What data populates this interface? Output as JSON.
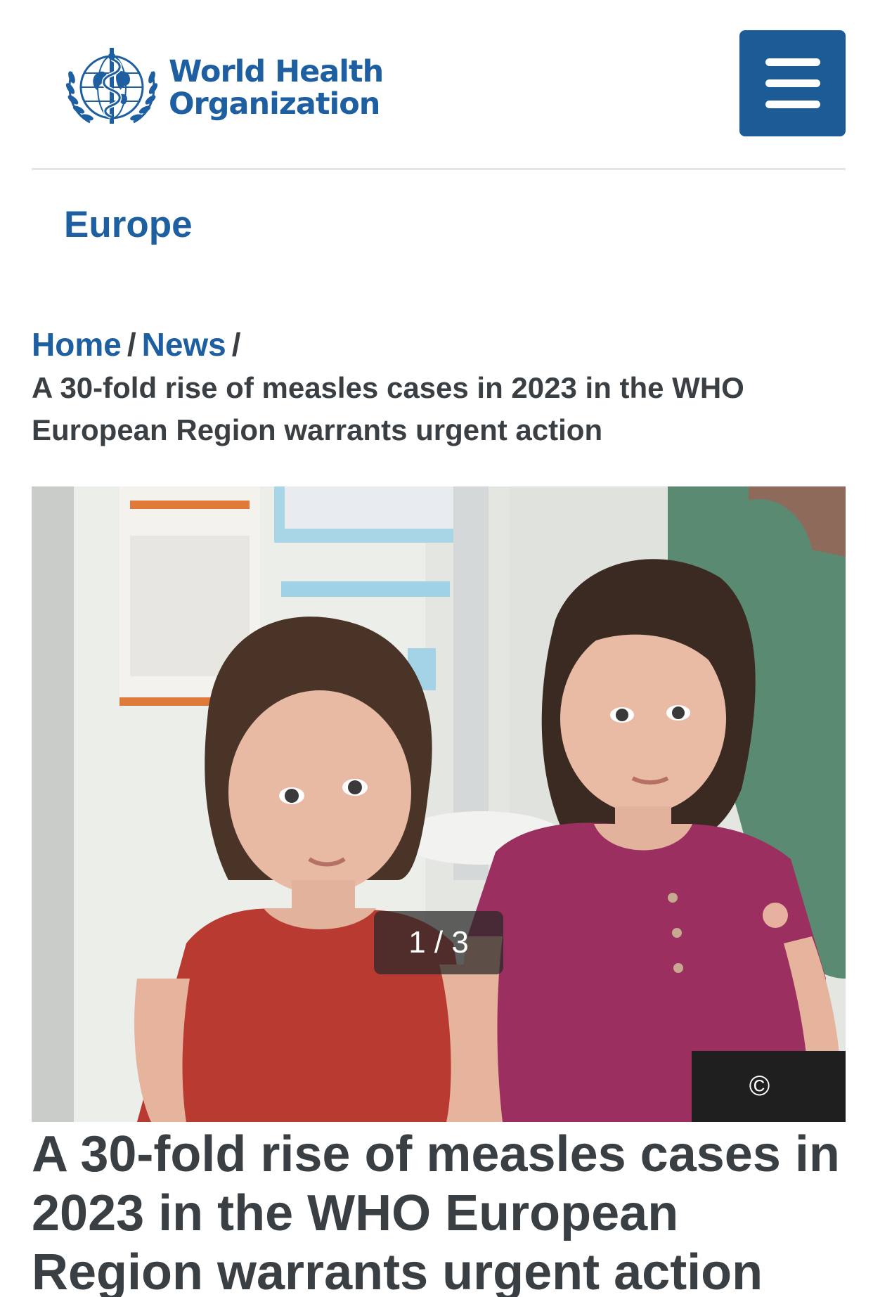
{
  "header": {
    "logo_line1": "World Health",
    "logo_line2": "Organization",
    "menu_icon": "hamburger-menu-icon"
  },
  "region": {
    "label": "Europe"
  },
  "breadcrumb": {
    "items": [
      {
        "label": "Home"
      },
      {
        "label": "News"
      }
    ],
    "separator": "/",
    "current": "A 30-fold rise of measles cases in 2023 in the WHO European Region warrants urgent action"
  },
  "hero": {
    "slide_counter": "1 / 3",
    "copyright_symbol": "©"
  },
  "article": {
    "title": "A 30-fold rise of measles cases in 2023 in the WHO European Region warrants urgent action"
  },
  "colors": {
    "brand_blue": "#1d5fa1",
    "menu_blue": "#1d5b96",
    "text_dark": "#3a3f44"
  }
}
